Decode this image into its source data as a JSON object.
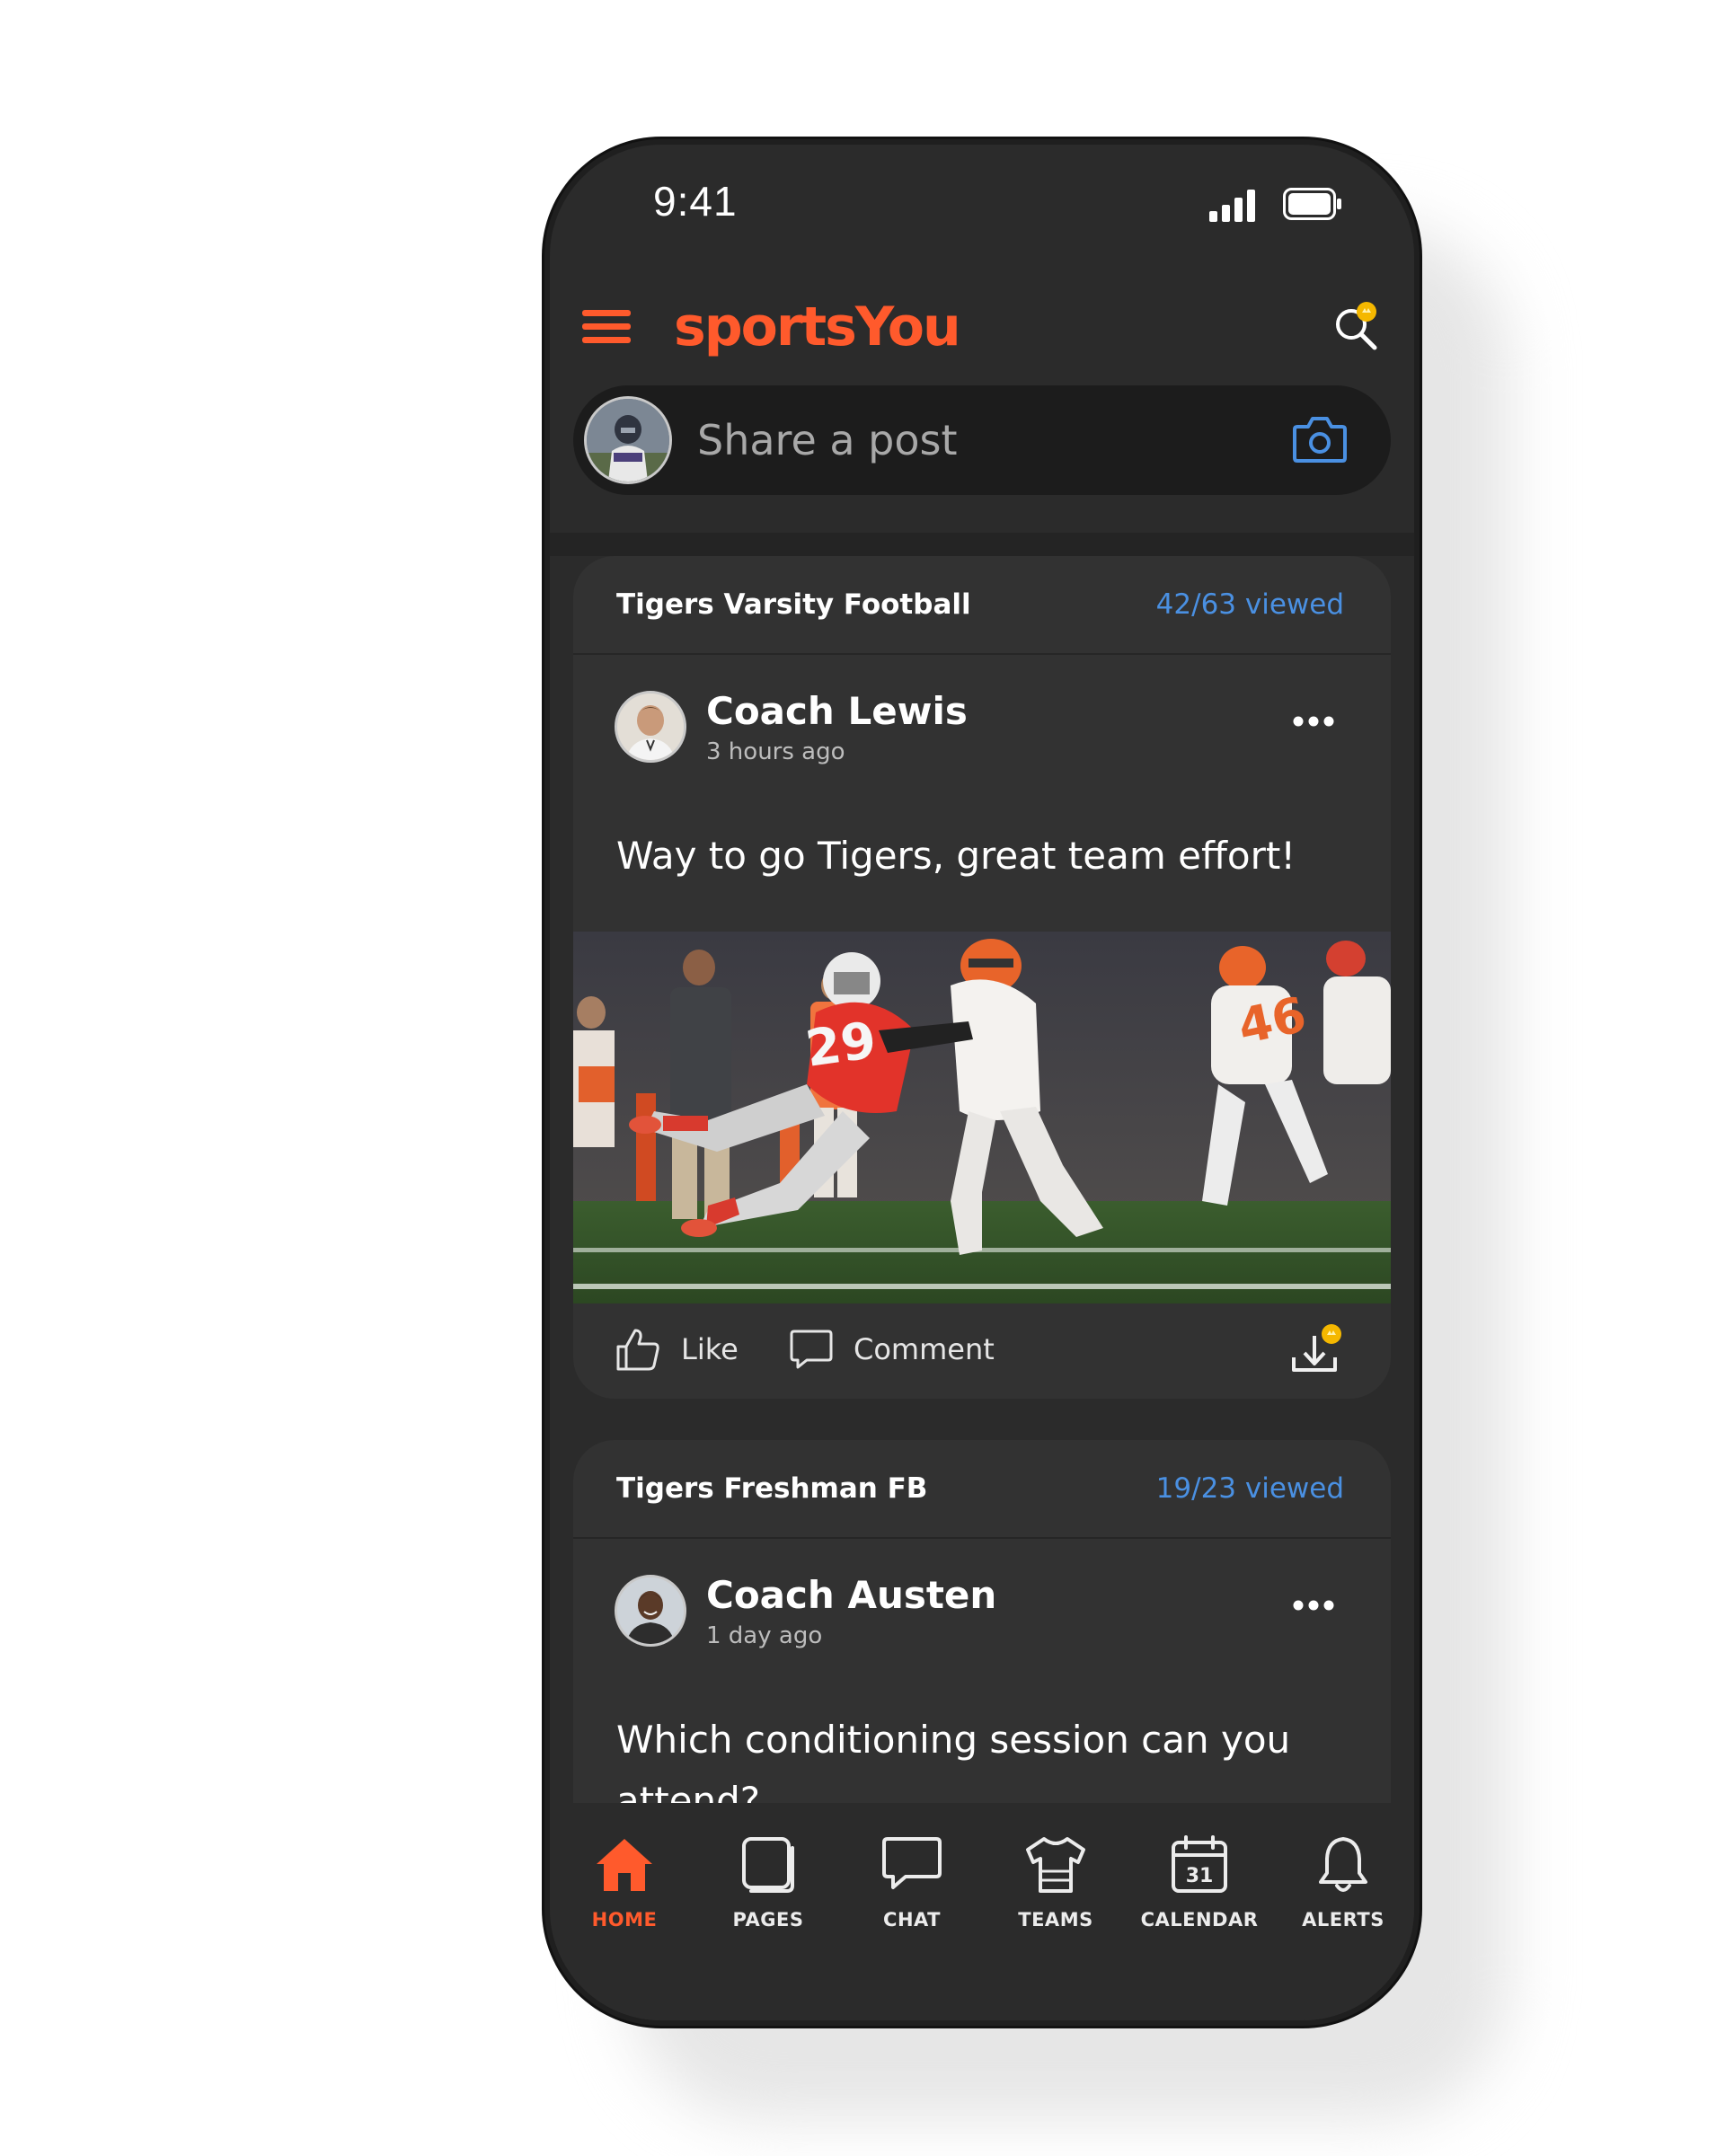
{
  "status_bar": {
    "time": "9:41"
  },
  "header": {
    "brand": "sportsYou"
  },
  "composer": {
    "placeholder": "Share a post"
  },
  "posts": [
    {
      "team": "Tigers Varsity Football",
      "viewed": "42/63 viewed",
      "author": "Coach Lewis",
      "time": "3 hours ago",
      "text": "Way to go Tigers, great team effort!",
      "has_image": true,
      "actions": {
        "like": "Like",
        "comment": "Comment"
      }
    },
    {
      "team": "Tigers Freshman FB",
      "viewed": "19/23 viewed",
      "author": "Coach Austen",
      "time": "1 day ago",
      "text": "Which conditioning session can you attend?"
    }
  ],
  "nav": [
    {
      "label": "HOME",
      "icon": "home-icon",
      "active": true
    },
    {
      "label": "PAGES",
      "icon": "pages-icon",
      "active": false
    },
    {
      "label": "CHAT",
      "icon": "chat-icon",
      "active": false
    },
    {
      "label": "TEAMS",
      "icon": "jersey-icon",
      "active": false
    },
    {
      "label": "CALENDAR",
      "icon": "calendar-icon",
      "active": false,
      "badge": "31"
    },
    {
      "label": "ALERTS",
      "icon": "bell-icon",
      "active": false
    }
  ],
  "colors": {
    "accent": "#ff5a2c",
    "link": "#4a90e2",
    "badge": "#f5b800",
    "background": "#2b2b2b"
  }
}
